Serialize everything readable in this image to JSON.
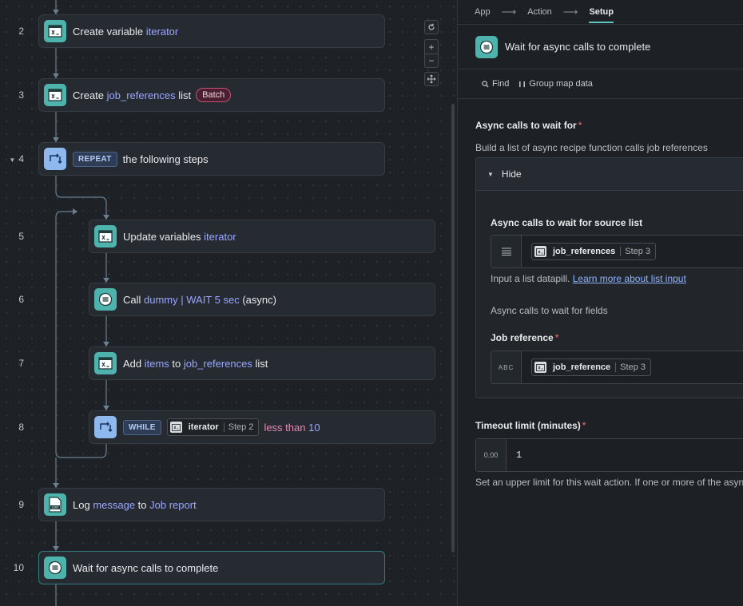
{
  "canvas": {
    "steps": [
      {
        "number": "2",
        "kind": "var",
        "segments": [
          {
            "text": "Create variable ",
            "t": "plain"
          },
          {
            "text": "iterator",
            "t": "token"
          }
        ]
      },
      {
        "number": "3",
        "kind": "var",
        "segments": [
          {
            "text": "Create ",
            "t": "plain"
          },
          {
            "text": "job_references",
            "t": "token"
          },
          {
            "text": " list",
            "t": "plain"
          }
        ],
        "badge": "Batch"
      },
      {
        "number": "4",
        "kind": "loop",
        "keyword": "REPEAT",
        "segments": [
          {
            "text": "the following steps",
            "t": "plain"
          }
        ]
      },
      {
        "number": "5",
        "kind": "var",
        "segments": [
          {
            "text": "Update variables ",
            "t": "plain"
          },
          {
            "text": "iterator",
            "t": "token"
          }
        ]
      },
      {
        "number": "6",
        "kind": "call",
        "segments": [
          {
            "text": "Call ",
            "t": "plain"
          },
          {
            "text": "dummy | WAIT 5 sec",
            "t": "token"
          },
          {
            "text": " (async)",
            "t": "plain"
          }
        ]
      },
      {
        "number": "7",
        "kind": "var",
        "segments": [
          {
            "text": "Add ",
            "t": "plain"
          },
          {
            "text": "items",
            "t": "token"
          },
          {
            "text": " to ",
            "t": "plain"
          },
          {
            "text": "job_references",
            "t": "token"
          },
          {
            "text": " list",
            "t": "plain"
          }
        ]
      },
      {
        "number": "8",
        "kind": "loop",
        "keyword": "WHILE",
        "pill": {
          "name": "iterator",
          "step": "Step 2"
        },
        "segments": [
          {
            "text": "less than ",
            "t": "pink"
          },
          {
            "text": "10",
            "t": "token"
          }
        ]
      },
      {
        "number": "9",
        "kind": "log",
        "segments": [
          {
            "text": "Log ",
            "t": "plain"
          },
          {
            "text": "message",
            "t": "token"
          },
          {
            "text": " to ",
            "t": "plain"
          },
          {
            "text": "Job report",
            "t": "token"
          }
        ]
      },
      {
        "number": "10",
        "kind": "call",
        "segments": [
          {
            "text": "Wait for async calls to complete",
            "t": "plain"
          }
        ],
        "active": true
      }
    ],
    "zoom": {
      "in": "+",
      "out": "−"
    }
  },
  "panel": {
    "breadcrumb": [
      "App",
      "Action",
      "Setup"
    ],
    "title": "Wait for async calls to complete",
    "toolbar": {
      "find": "Find",
      "group_map": "Group map data"
    },
    "async_calls": {
      "label": "Async calls to wait for",
      "required": "*",
      "hint": "Build a list of async recipe function calls job references",
      "toggle": "Hide",
      "source_list": {
        "label": "Async calls to wait for source list",
        "pill": {
          "name": "job_references",
          "step": "Step 3"
        },
        "hint_text": "Input a list datapill. ",
        "hint_link": "Learn more about list input"
      },
      "fields_label": "Async calls to wait for fields",
      "job_reference": {
        "label": "Job reference",
        "required": "*",
        "type_tag": "ABC",
        "pill": {
          "name": "job_reference",
          "step": "Step 3"
        }
      }
    },
    "timeout": {
      "label": "Timeout limit (minutes)",
      "required": "*",
      "type_tag": "0.00",
      "value": "1",
      "hint": "Set an upper limit for this wait action. If one or more of the async"
    }
  }
}
